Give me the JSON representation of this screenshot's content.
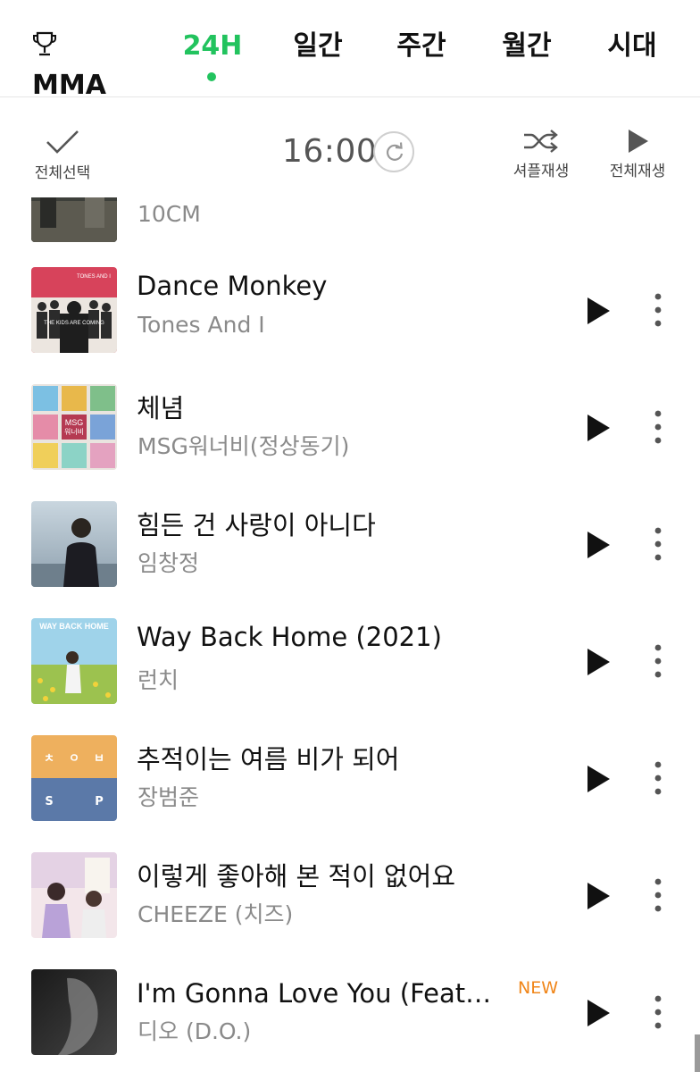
{
  "tabs": {
    "mma": "MMA",
    "h24": "24H",
    "daily": "일간",
    "weekly": "주간",
    "monthly": "월간",
    "era": "시대"
  },
  "toolbar": {
    "select_all": "전체선택",
    "time": "16:00",
    "shuffle": "셔플재생",
    "play_all": "전체재생"
  },
  "songs": [
    {
      "title": "",
      "artist": "10CM"
    },
    {
      "title": "Dance Monkey",
      "artist": "Tones And I"
    },
    {
      "title": "체념",
      "artist": "MSG워너비(정상동기)"
    },
    {
      "title": "힘든 건 사랑이 아니다",
      "artist": "임창정"
    },
    {
      "title": "Way Back Home (2021)",
      "artist": "런치"
    },
    {
      "title": "추적이는 여름 비가 되어",
      "artist": "장범준"
    },
    {
      "title": "이렇게 좋아해 본 적이 없어요",
      "artist": "CHEEZE (치즈)"
    },
    {
      "title": "I'm Gonna Love You (Feat. 원슈타인)",
      "artist": "디오 (D.O.)",
      "badge": "NEW"
    }
  ],
  "album_art_text": {
    "dance_monkey": [
      "TONES AND I",
      "THE KIDS ARE COMING"
    ],
    "msg": [
      "MSG",
      "워너비"
    ],
    "way_back_home": "WAY BACK HOME",
    "chujeok": [
      "ㅊ",
      "ㅇ",
      "ㅂ",
      "S",
      "P"
    ]
  },
  "colors": {
    "accent": "#22c35e",
    "new_badge": "#f0861a",
    "artist_text": "#8a8a8a"
  },
  "icons": {
    "mma": "trophy-icon",
    "select_all": "check-icon",
    "refresh": "refresh-icon",
    "shuffle": "shuffle-icon",
    "play_all": "play-icon",
    "row_play": "play-icon",
    "row_more": "more-vertical-icon"
  }
}
